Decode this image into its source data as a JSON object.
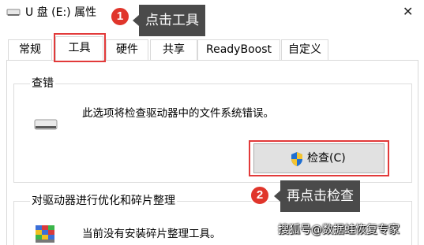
{
  "window": {
    "title": "U 盘 (E:) 属性",
    "close_glyph": "✕"
  },
  "tabs": [
    {
      "label": "常规",
      "active": false
    },
    {
      "label": "工具",
      "active": true
    },
    {
      "label": "硬件",
      "active": false
    },
    {
      "label": "共享",
      "active": false
    },
    {
      "label": "ReadyBoost",
      "active": false
    },
    {
      "label": "自定义",
      "active": false
    }
  ],
  "check_group": {
    "title": "查错",
    "description": "此选项将检查驱动器中的文件系统错误。",
    "button_label": "检查(C)",
    "button_icon": "uac-shield-icon"
  },
  "optimize_group": {
    "title": "对驱动器进行优化和碎片整理",
    "description": "当前没有安装碎片整理工具。",
    "icon": "defrag-icon"
  },
  "annotations": {
    "step1": {
      "number": "1",
      "text": "点击工具"
    },
    "step2": {
      "number": "2",
      "text": "再点击检查"
    }
  },
  "watermark": "搜狐号@数据蛙恢复专家",
  "colors": {
    "highlight": "#e23a3a",
    "callout_bg": "#4a4a4a",
    "badge": "#e0352b"
  }
}
